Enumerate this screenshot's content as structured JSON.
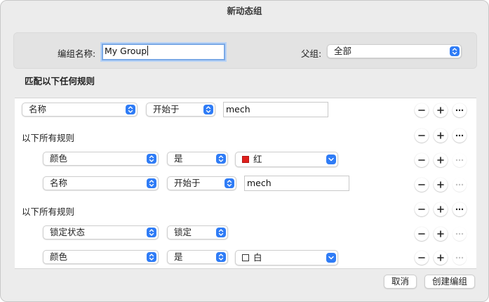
{
  "window": {
    "title": "新动态组"
  },
  "header": {
    "name_label": "编组名称:",
    "name_value": "My Group",
    "parent_label": "父组:",
    "parent_value": "全部"
  },
  "rules_title": "匹配以下任何规则",
  "rules": [
    {
      "field": "名称",
      "operator": "开始于",
      "value": "mech"
    },
    {
      "group_label": "以下所有规则"
    },
    {
      "field": "颜色",
      "operator": "是",
      "value": "红",
      "swatch": "#e0201c"
    },
    {
      "field": "名称",
      "operator": "开始于",
      "value": "mech"
    },
    {
      "group_label": "以下所有规则"
    },
    {
      "field": "锁定状态",
      "operator": "锁定"
    },
    {
      "field": "颜色",
      "operator": "是",
      "value": "白",
      "swatch": "#ffffff"
    }
  ],
  "buttons": {
    "cancel": "取消",
    "create": "创建编组"
  },
  "colors": {
    "accent": "#2f7cf6",
    "focus_ring": "#7aa9e6"
  }
}
